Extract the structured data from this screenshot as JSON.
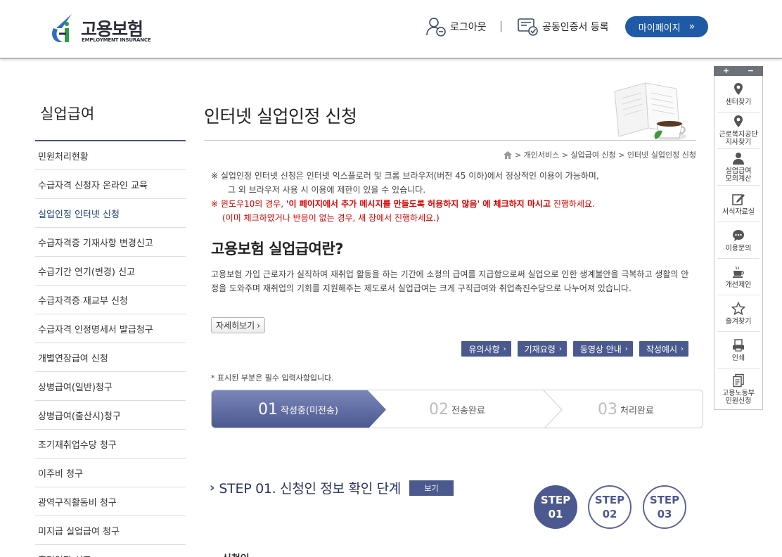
{
  "header": {
    "logo_title": "고용보험",
    "logo_sub": "EMPLOYMENT INSURANCE",
    "logout": "로그아웃",
    "cert": "공동인증서 등록",
    "mypage": "마이페이지",
    "mypage_chev": "»"
  },
  "sidebar": {
    "title": "실업급여",
    "items": [
      {
        "label": "민원처리현황"
      },
      {
        "label": "수급자격 신청자 온라인 교육"
      },
      {
        "label": "실업인정 인터넷 신청"
      },
      {
        "label": "수급자격증 기재사항 변경신고"
      },
      {
        "label": "수급기간 연기(변경) 신고"
      },
      {
        "label": "수급자격증 재교부 신청"
      },
      {
        "label": "수급자격 인정명세서 발급청구"
      },
      {
        "label": "개별연장급여 신청"
      },
      {
        "label": "상병급여(일반)청구"
      },
      {
        "label": "상병급여(출산시)청구"
      },
      {
        "label": "조기재취업수당 청구"
      },
      {
        "label": "이주비 청구"
      },
      {
        "label": "광역구직활동비 청구"
      },
      {
        "label": "미지급 실업급여 청구"
      },
      {
        "label": "훈련연장 신고"
      }
    ]
  },
  "main": {
    "title": "인터넷 실업인정 신청",
    "breadcrumb": "> 개인서비스 > 실업급여 신청 > 인터넷 실업인정 신청",
    "notice1": "※ 실업인정 인터넷 신청은 인터넷 익스플로러 및 크롬 브라우저(버전 45 이하)에서 정상적인 이용이 가능하며,",
    "notice2": "그 외 브라우저 사용 시 이용에 제한이 있을 수 있습니다.",
    "notice3_a": "※ 윈도우10의 경우,",
    "notice3_b": "'이 페이지에서 추가 메시지를 만들도록 허용하지 않음' 에 체크하지 마시고",
    "notice3_c": "진행하세요.",
    "notice4": "(이미 체크하였거나 반응이 없는 경우, 새 창에서 진행하세요.)",
    "section_title": "고용보험 실업급여란?",
    "description": "고용보험 가입 근로자가 실직하여 재취업 활동을 하는 기간에 소정의 급여를 지급함으로써 실업으로 인한 생계불안을 극복하고 생활의 안정을 도와주며 재취업의 기회를 지원해주는 제도로서 실업급여는 크게 구직급여와 취업촉진수당으로 나누어져 있습니다.",
    "more": "자세히보기",
    "more_chev": "›",
    "buttons": [
      {
        "label": "유의사항"
      },
      {
        "label": "기재요령"
      },
      {
        "label": "동영상 안내"
      },
      {
        "label": "작성예시"
      }
    ],
    "btn_chev": "›",
    "req_note": "* 표시된 부분은 필수 입력사항입니다.",
    "progress": [
      {
        "num": "01",
        "label": "작성중(미전송)"
      },
      {
        "num": "02",
        "label": "전송완료"
      },
      {
        "num": "03",
        "label": "처리완료"
      }
    ],
    "step_arrow": "›",
    "step_title": "STEP 01. 신청인 정보 확인 단계",
    "view": "보기",
    "circles": [
      {
        "top": "STEP",
        "bottom": "01"
      },
      {
        "top": "STEP",
        "bottom": "02"
      },
      {
        "top": "STEP",
        "bottom": "03"
      }
    ],
    "applicant": "신청인"
  },
  "quick": {
    "plus": "+",
    "minus": "−",
    "items": [
      {
        "label": "센터찾기",
        "icon": "location-icon"
      },
      {
        "label": "근로복지공단\n지사찾기",
        "icon": "location-icon"
      },
      {
        "label": "실업급여\n모의계산",
        "icon": "person-icon"
      },
      {
        "label": "서식자료실",
        "icon": "edit-icon"
      },
      {
        "label": "이용문의",
        "icon": "chat-icon"
      },
      {
        "label": "개선제안",
        "icon": "cup-icon"
      },
      {
        "label": "즐겨찾기",
        "icon": "star-icon"
      },
      {
        "label": "인쇄",
        "icon": "print-icon"
      },
      {
        "label": "고용노동부\n민원신청",
        "icon": "document-icon"
      }
    ]
  },
  "colors": {
    "brand_blue": "#1f5aa6",
    "button_navy": "#4b5a8e",
    "notice_red": "#d60000"
  }
}
